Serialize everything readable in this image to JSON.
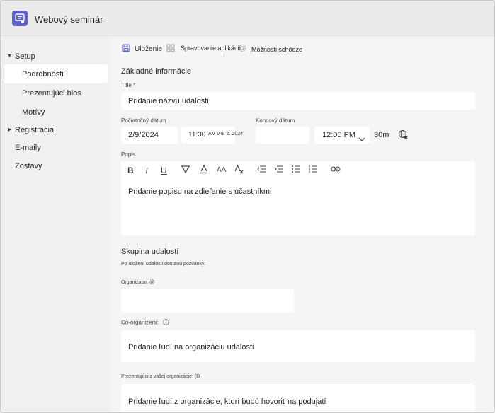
{
  "window": {
    "title": "Webový seminár"
  },
  "sidebar": {
    "items": [
      {
        "label": "Setup",
        "expanded": true
      },
      {
        "label": "Podrobnosti",
        "selected": true
      },
      {
        "label": "Prezentujúci bios"
      },
      {
        "label": "Motívy"
      },
      {
        "label": "Registrácia",
        "expanded": false
      },
      {
        "label": "E-maily"
      },
      {
        "label": "Zostavy"
      }
    ]
  },
  "toolbar": {
    "save_label": "Uloženie",
    "manage_apps_label": "Spravovanie aplikácií",
    "meeting_options_label": "Možnosti schôdze"
  },
  "basic": {
    "heading": "Základné informácie",
    "title_label": "Title",
    "required_mark": "*",
    "title_placeholder": "Pridanie názvu udalosti",
    "start_label": "Počiatočný dátum",
    "start_date": "2/9/2024",
    "start_time": "11:30",
    "start_time_note": "AM v 9. 2. 2024",
    "end_label": "Koncový dátum",
    "end_time": "12:00 PM",
    "duration": "30m",
    "desc_label": "Popis",
    "desc_placeholder": "Pridanie popisu na zdieľanie s účastníkmi"
  },
  "group": {
    "heading": "Skupina udalostí",
    "note": "Po uložení udalosti dostanú pozvánky.",
    "organizer_label": "Organizátor. @",
    "coorg_label": "Co-organizers:",
    "coorg_placeholder": "Pridanie ľudí na organizáciu udalosti",
    "presenters_label": "Prezentujúci z vašej organizácie: (D",
    "presenters_placeholder": "Pridanie ľudí z organizácie, ktorí budú hovoriť na podujatí"
  },
  "colors": {
    "accent": "#5b5fc7",
    "required": "#c4314b"
  },
  "icons": [
    "app-icon",
    "save-icon",
    "apps-icon",
    "options-icon",
    "globe-icon",
    "chevron-down-icon",
    "info-icon"
  ]
}
